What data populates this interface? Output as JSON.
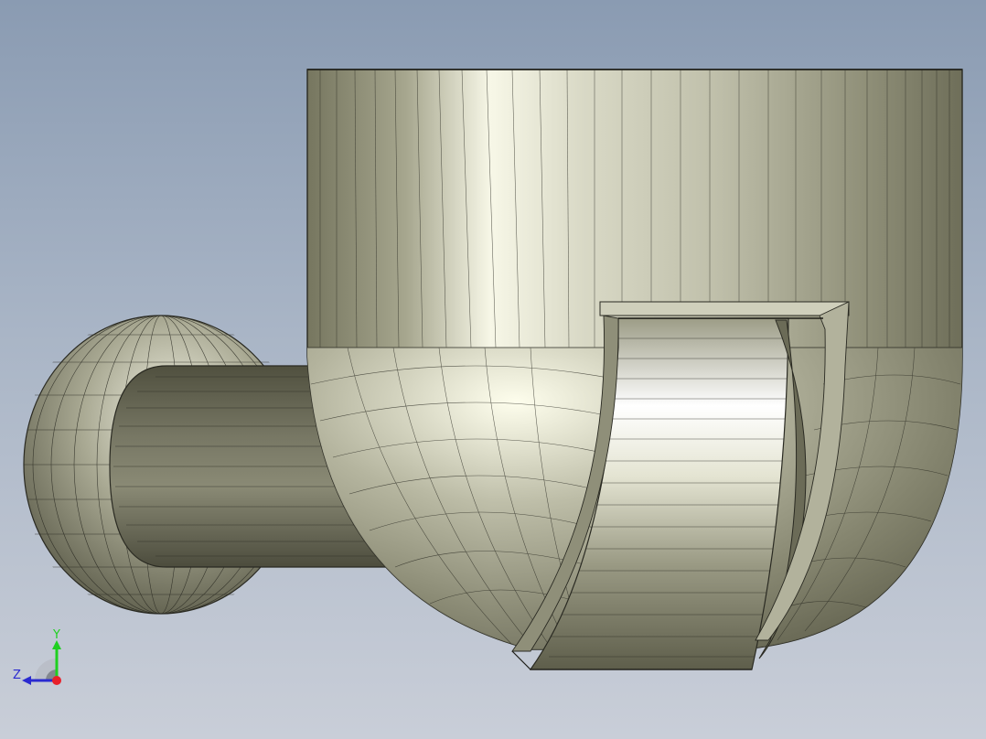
{
  "view": {
    "background_top": "#8a9bb2",
    "background_bottom": "#c9ced8",
    "model_color": "#8d8d78",
    "edge_color": "#2a2a22"
  },
  "triad": {
    "labels": {
      "y": "Y",
      "z": "Z"
    },
    "colors": {
      "x": "#e8202a",
      "y": "#1fd020",
      "z": "#2a2ad0"
    }
  }
}
